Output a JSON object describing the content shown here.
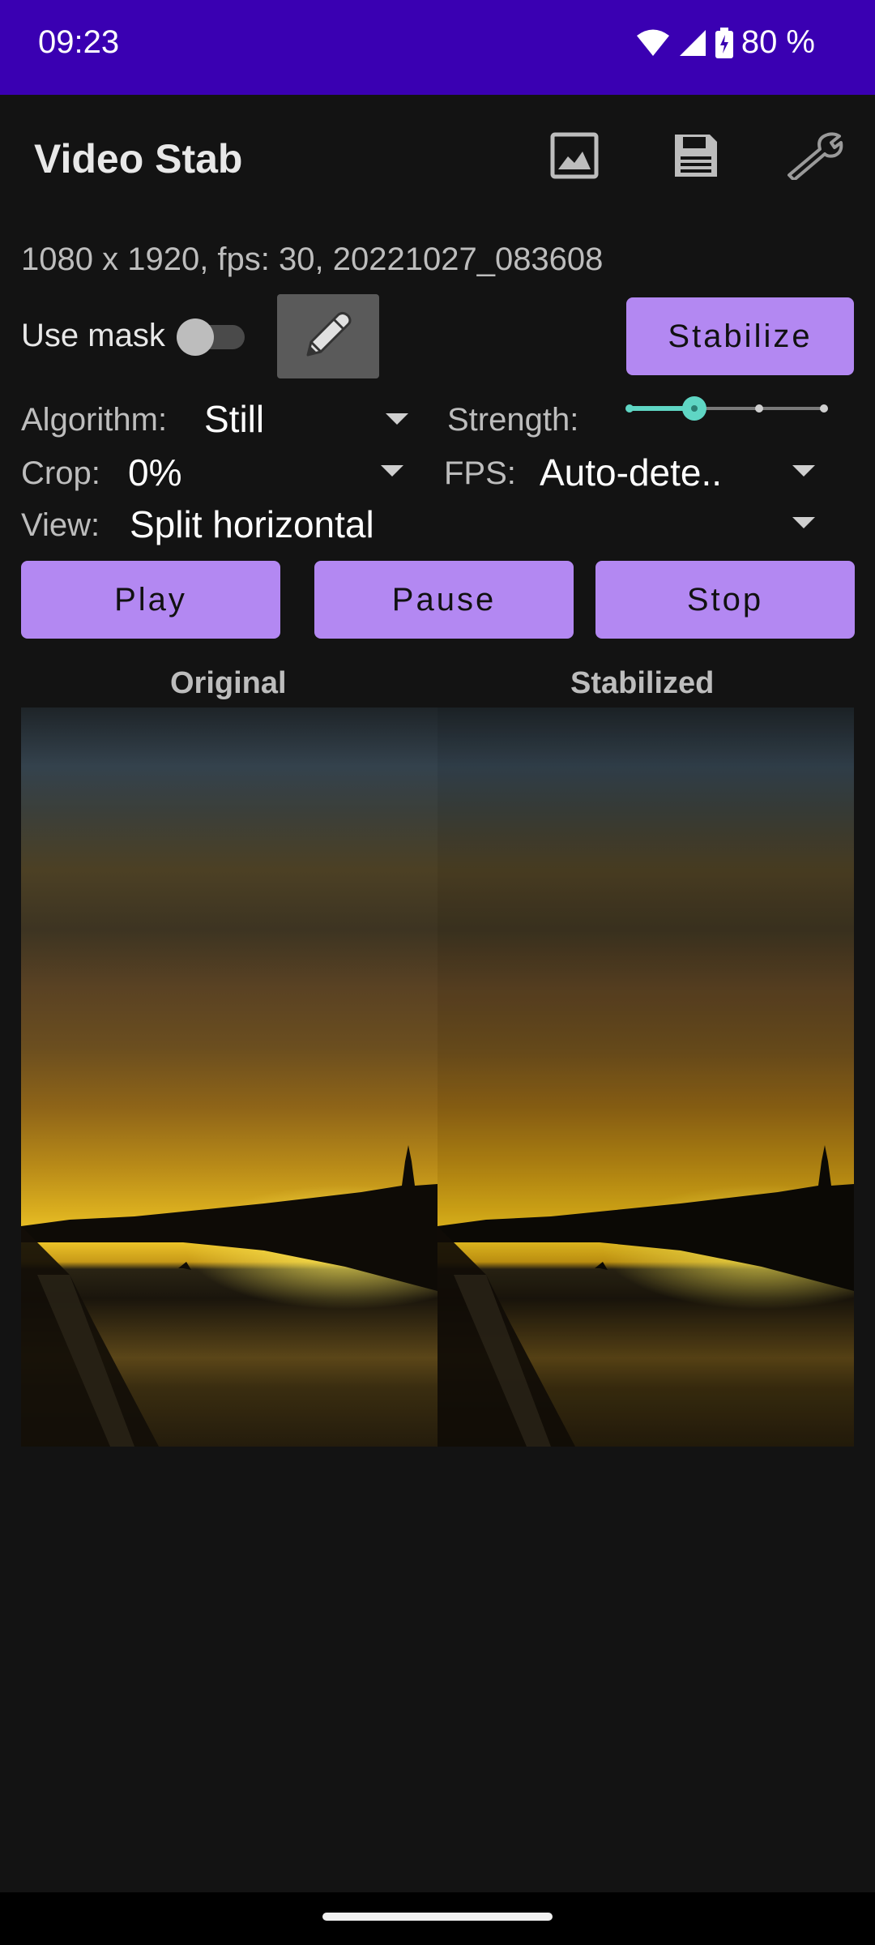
{
  "status_bar": {
    "time": "09:23",
    "battery": "80 %"
  },
  "app_bar": {
    "title": "Video Stab",
    "icons": [
      "image-icon",
      "save-icon",
      "wrench-icon"
    ]
  },
  "file_info": "1080 x 1920, fps: 30, 20221027_083608",
  "mask": {
    "label": "Use mask",
    "enabled": false
  },
  "buttons": {
    "stabilize": "Stabilize",
    "play": "Play",
    "pause": "Pause",
    "stop": "Stop"
  },
  "settings": {
    "algorithm_label": "Algorithm:",
    "algorithm_value": "Still",
    "strength_label": "Strength:",
    "strength_level": 1,
    "strength_steps": 4,
    "crop_label": "Crop:",
    "crop_value": "0%",
    "fps_label": "FPS:",
    "fps_value": "Auto-dete..",
    "view_label": "View:",
    "view_value": "Split horizontal"
  },
  "panes": {
    "left_label": "Original",
    "right_label": "Stabilized"
  },
  "colors": {
    "status_bar": "#3a00b2",
    "accent_button": "#b388f2",
    "slider_active": "#5fd6c4",
    "background": "#131313"
  }
}
